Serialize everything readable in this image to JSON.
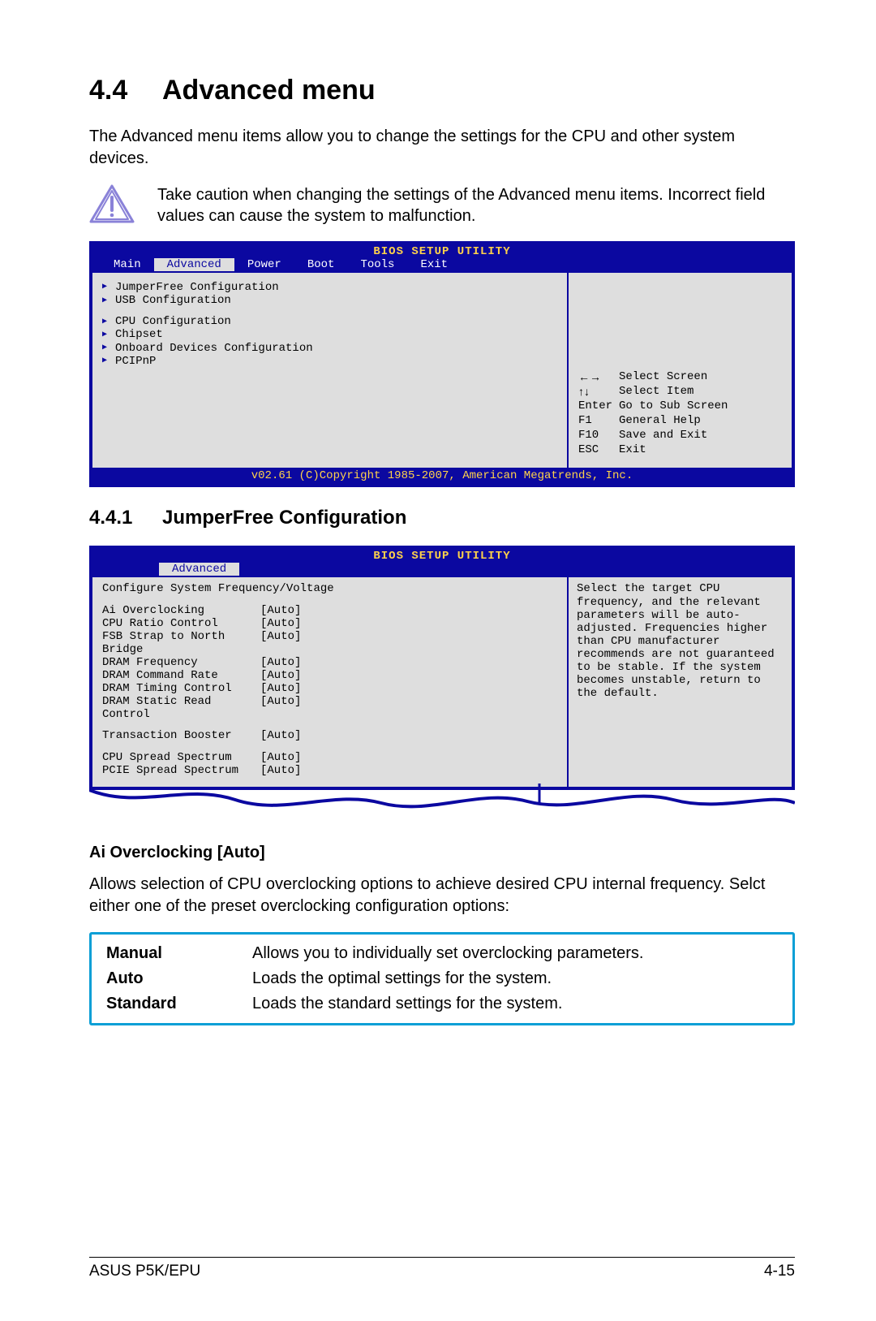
{
  "heading": {
    "num": "4.4",
    "title": "Advanced menu"
  },
  "intro": "The Advanced menu items allow you to change the settings for the CPU and other system devices.",
  "caution": "Take caution when changing the settings of the Advanced menu items. Incorrect field values can cause the system to malfunction.",
  "bios1": {
    "title": "BIOS SETUP UTILITY",
    "tabs": [
      "Main",
      "Advanced",
      "Power",
      "Boot",
      "Tools",
      "Exit"
    ],
    "activeTab": "Advanced",
    "group1": [
      "JumperFree Configuration",
      "USB Configuration"
    ],
    "group2": [
      "CPU Configuration",
      "Chipset",
      "Onboard Devices Configuration",
      "PCIPnP"
    ],
    "keys": [
      {
        "k": "←→",
        "d": "Select Screen"
      },
      {
        "k": "↑↓",
        "d": "Select Item"
      },
      {
        "k": "Enter",
        "d": "Go to Sub Screen"
      },
      {
        "k": "F1",
        "d": "General Help"
      },
      {
        "k": "F10",
        "d": "Save and Exit"
      },
      {
        "k": "ESC",
        "d": "Exit"
      }
    ],
    "copyright": "v02.61 (C)Copyright 1985-2007, American Megatrends, Inc."
  },
  "subheading": {
    "num": "4.4.1",
    "title": "JumperFree Configuration"
  },
  "bios2": {
    "title": "BIOS SETUP UTILITY",
    "activeTab": "Advanced",
    "header": "Configure System Frequency/Voltage",
    "settings1": [
      {
        "n": "Ai Overclocking",
        "v": "[Auto]"
      },
      {
        "n": "CPU Ratio Control",
        "v": "[Auto]"
      },
      {
        "n": "FSB Strap to North Bridge",
        "v": "[Auto]"
      },
      {
        "n": "DRAM Frequency",
        "v": "[Auto]"
      },
      {
        "n": "DRAM Command Rate",
        "v": "[Auto]"
      },
      {
        "n": "DRAM Timing Control",
        "v": "[Auto]"
      },
      {
        "n": "DRAM Static Read Control",
        "v": "[Auto]"
      }
    ],
    "settings2": [
      {
        "n": "Transaction Booster",
        "v": "[Auto]"
      }
    ],
    "settings3": [
      {
        "n": "CPU Spread Spectrum",
        "v": "[Auto]"
      },
      {
        "n": "PCIE Spread Spectrum",
        "v": "[Auto]"
      }
    ],
    "help": "Select the target CPU frequency, and the relevant parameters will be auto-adjusted. Frequencies higher than CPU manufacturer recommends are not guaranteed to be stable. If the system becomes unstable, return to the default."
  },
  "item": {
    "title": "Ai Overclocking [Auto]",
    "desc": "Allows selection of CPU overclocking options to achieve desired CPU internal frequency. Selct either one of the preset overclocking configuration options:"
  },
  "options": [
    {
      "name": "Manual",
      "desc": "Allows you to individually set overclocking parameters."
    },
    {
      "name": "Auto",
      "desc": "Loads the optimal settings for the system."
    },
    {
      "name": "Standard",
      "desc": "Loads the standard settings for the system."
    }
  ],
  "footer": {
    "left": "ASUS P5K/EPU",
    "right": "4-15"
  }
}
